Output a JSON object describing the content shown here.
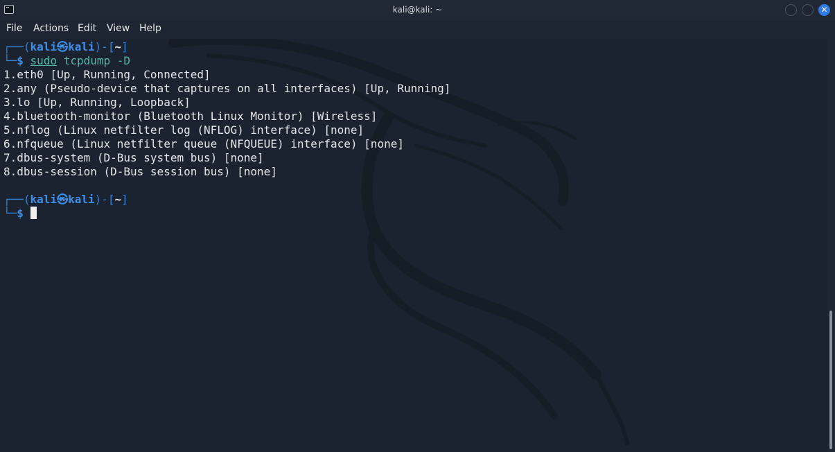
{
  "window": {
    "title": "kali@kali: ~",
    "close_glyph": "✕",
    "accent_color": "#2f7ae5"
  },
  "menu": [
    "File",
    "Actions",
    "Edit",
    "View",
    "Help"
  ],
  "terminal": {
    "prompt1": {
      "frame_open": "┌──(",
      "user": "kali",
      "at_symbol": "㉿",
      "host": "kali",
      "frame_mid": ")-[",
      "path": "~",
      "frame_close": "]",
      "frame_bottom": "└─",
      "dollar": "$",
      "command_sudo": "sudo",
      "command_rest": " tcpdump -D"
    },
    "output": [
      "1.eth0 [Up, Running, Connected]",
      "2.any (Pseudo-device that captures on all interfaces) [Up, Running]",
      "3.lo [Up, Running, Loopback]",
      "4.bluetooth-monitor (Bluetooth Linux Monitor) [Wireless]",
      "5.nflog (Linux netfilter log (NFLOG) interface) [none]",
      "6.nfqueue (Linux netfilter queue (NFQUEUE) interface) [none]",
      "7.dbus-system (D-Bus system bus) [none]",
      "8.dbus-session (D-Bus session bus) [none]"
    ],
    "prompt2": {
      "frame_open": "┌──(",
      "user": "kali",
      "at_symbol": "㉿",
      "host": "kali",
      "frame_mid": ")-[",
      "path": "~",
      "frame_close": "]",
      "frame_bottom": "└─",
      "dollar": "$"
    },
    "colors": {
      "prompt_frame": "#2f84d9",
      "command": "#4fb6a7",
      "text": "#e4e7ea",
      "background": "#1b2330"
    }
  }
}
